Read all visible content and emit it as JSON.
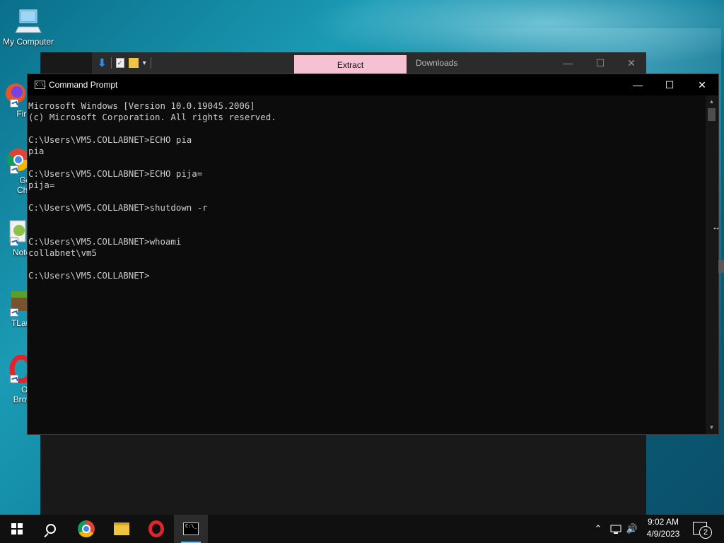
{
  "desktop": {
    "icons": [
      {
        "label": "My Computer"
      },
      {
        "label": "Fire"
      },
      {
        "label": "Goo Chro"
      },
      {
        "label": "Notep"
      },
      {
        "label": "TLaun"
      },
      {
        "label": "Op Brow"
      }
    ]
  },
  "explorer": {
    "tab_label": "Extract",
    "title": "Downloads"
  },
  "cmd": {
    "title": "Command Prompt",
    "icon_text": "C:\\_",
    "lines": [
      "Microsoft Windows [Version 10.0.19045.2006]",
      "(c) Microsoft Corporation. All rights reserved.",
      "",
      "C:\\Users\\VM5.COLLABNET>ECHO pia",
      "pia",
      "",
      "C:\\Users\\VM5.COLLABNET>ECHO pija=",
      "pija=",
      "",
      "C:\\Users\\VM5.COLLABNET>shutdown -r",
      "",
      "",
      "C:\\Users\\VM5.COLLABNET>whoami",
      "collabnet\\vm5",
      "",
      "C:\\Users\\VM5.COLLABNET>"
    ]
  },
  "taskbar": {
    "pinned": [
      "windows-start",
      "search",
      "chrome",
      "file-explorer",
      "opera",
      "command-prompt"
    ],
    "clock_time": "9:02 AM",
    "clock_date": "4/9/2023",
    "notification_count": "2"
  }
}
